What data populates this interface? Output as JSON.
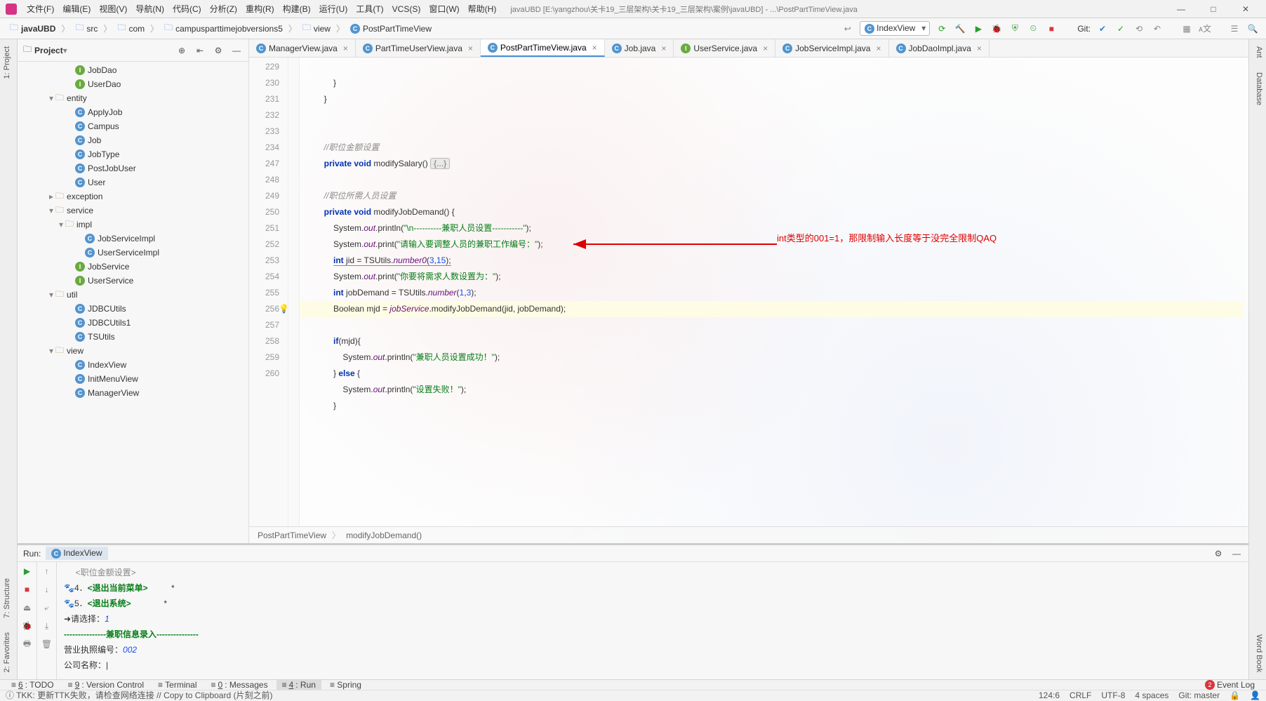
{
  "window": {
    "title": "javaUBD [E:\\yangzhou\\关卡19_三层架构\\关卡19_三层架构\\案例\\javaUBD] - ...\\PostPartTimeView.java",
    "minimize": "—",
    "maximize": "□",
    "close": "✕"
  },
  "menu": [
    "文件(F)",
    "编辑(E)",
    "视图(V)",
    "导航(N)",
    "代码(C)",
    "分析(Z)",
    "重构(R)",
    "构建(B)",
    "运行(U)",
    "工具(T)",
    "VCS(S)",
    "窗口(W)",
    "帮助(H)"
  ],
  "breadcrumbs": [
    {
      "icon": "fld",
      "text": "javaUBD",
      "bold": true
    },
    {
      "icon": "fld",
      "text": "src"
    },
    {
      "icon": "fld",
      "text": "com"
    },
    {
      "icon": "fld",
      "text": "campusparttimejobversions5"
    },
    {
      "icon": "fld",
      "text": "view"
    },
    {
      "icon": "cls",
      "text": "PostPartTimeView"
    }
  ],
  "run_config": "IndexView",
  "git_label": "Git:",
  "left_tabs": [
    "1: Project",
    "7: Structure",
    "2: Favorites"
  ],
  "right_tabs": [
    "Ant",
    "Database",
    "Word Book"
  ],
  "project": {
    "title": "Project",
    "tree": [
      {
        "d": 5,
        "ico": "i",
        "txt": "JobDao"
      },
      {
        "d": 5,
        "ico": "i",
        "txt": "UserDao"
      },
      {
        "d": 3,
        "ico": "fld",
        "txt": "entity",
        "exp": true
      },
      {
        "d": 5,
        "ico": "c",
        "txt": "ApplyJob"
      },
      {
        "d": 5,
        "ico": "c",
        "txt": "Campus"
      },
      {
        "d": 5,
        "ico": "c",
        "txt": "Job"
      },
      {
        "d": 5,
        "ico": "c",
        "txt": "JobType"
      },
      {
        "d": 5,
        "ico": "c",
        "txt": "PostJobUser"
      },
      {
        "d": 5,
        "ico": "c",
        "txt": "User"
      },
      {
        "d": 3,
        "ico": "fld",
        "txt": "exception",
        "exp": false
      },
      {
        "d": 3,
        "ico": "fld",
        "txt": "service",
        "exp": true
      },
      {
        "d": 4,
        "ico": "fld",
        "txt": "impl",
        "exp": true
      },
      {
        "d": 6,
        "ico": "c",
        "txt": "JobServiceImpl"
      },
      {
        "d": 6,
        "ico": "c",
        "txt": "UserServiceImpl"
      },
      {
        "d": 5,
        "ico": "i",
        "txt": "JobService"
      },
      {
        "d": 5,
        "ico": "i",
        "txt": "UserService"
      },
      {
        "d": 3,
        "ico": "fld",
        "txt": "util",
        "exp": true
      },
      {
        "d": 5,
        "ico": "c",
        "txt": "JDBCUtils"
      },
      {
        "d": 5,
        "ico": "c",
        "txt": "JDBCUtils1"
      },
      {
        "d": 5,
        "ico": "c",
        "txt": "TSUtils"
      },
      {
        "d": 3,
        "ico": "fld",
        "txt": "view",
        "exp": true
      },
      {
        "d": 5,
        "ico": "c",
        "txt": "IndexView"
      },
      {
        "d": 5,
        "ico": "c",
        "txt": "InitMenuView"
      },
      {
        "d": 5,
        "ico": "c",
        "txt": "ManagerView"
      }
    ]
  },
  "editor_tabs": [
    {
      "ico": "c",
      "txt": "ManagerView.java"
    },
    {
      "ico": "c",
      "txt": "PartTimeUserView.java"
    },
    {
      "ico": "c",
      "txt": "PostPartTimeView.java",
      "active": true
    },
    {
      "ico": "c",
      "txt": "Job.java"
    },
    {
      "ico": "i",
      "txt": "UserService.java"
    },
    {
      "ico": "c",
      "txt": "JobServiceImpl.java"
    },
    {
      "ico": "c",
      "txt": "JobDaoImpl.java"
    }
  ],
  "code_lines": [
    229,
    230,
    231,
    232,
    233,
    234,
    247,
    248,
    249,
    250,
    251,
    252,
    253,
    254,
    255,
    256,
    257,
    258,
    259,
    260
  ],
  "editor_crumbs": [
    "PostPartTimeView",
    "modifyJobDemand()"
  ],
  "annotation": "int类型的001=1，那限制输入长度等于没完全限制QAQ",
  "run": {
    "label": "Run:",
    "config": "IndexView",
    "output": {
      "l1_a": "🐾4．",
      "l1_b": "<退出当前菜单>",
      "l1_c": "*",
      "l2_a": "🐾5．",
      "l2_b": "<退出系统>",
      "l2_c": "*",
      "l3_a": "➜请选择：",
      "l3_b": "1",
      "l4": "---------------兼职信息录入---------------",
      "l5_a": "营业执照编号：",
      "l5_b": "002",
      "l6": "公司名称：|"
    }
  },
  "bottom_tabs": [
    {
      "u": "6",
      "txt": "TODO"
    },
    {
      "u": "9",
      "txt": "Version Control"
    },
    {
      "txt": "Terminal"
    },
    {
      "u": "0",
      "txt": "Messages"
    },
    {
      "u": "4",
      "txt": "Run",
      "active": true
    },
    {
      "txt": "Spring"
    }
  ],
  "event_log": "Event Log",
  "status": {
    "msg": "TKK: 更新TTK失败，请检查网络连接 // Copy to Clipboard (片刻之前)",
    "pos": "124:6",
    "crlf": "CRLF",
    "enc": "UTF-8",
    "indent": "4 spaces",
    "git": "Git: master"
  }
}
